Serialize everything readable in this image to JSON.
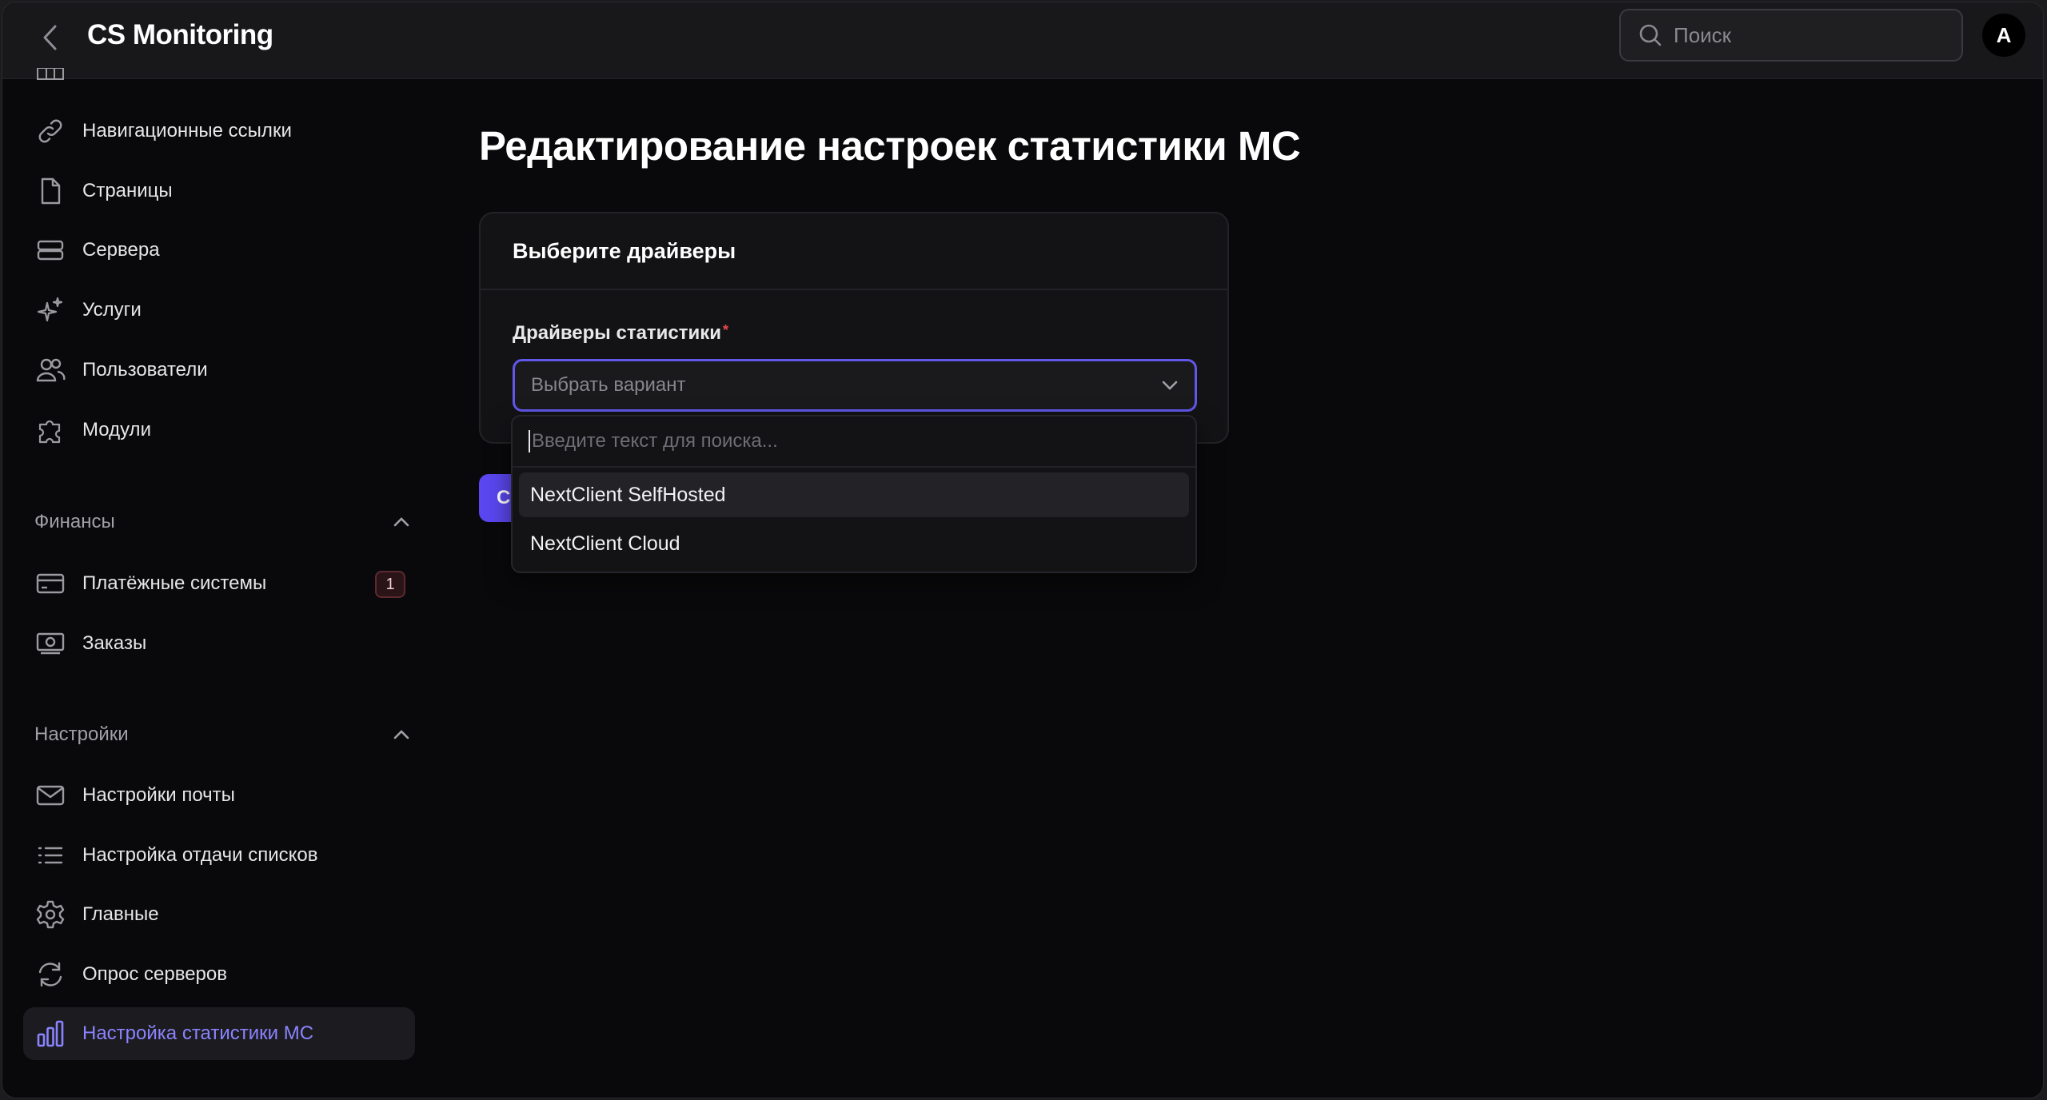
{
  "topbar": {
    "brand": "CS Monitoring",
    "search_placeholder": "Поиск",
    "avatar_initial": "A"
  },
  "sidebar": {
    "items_top": [
      {
        "label": "Навигационные ссылки",
        "icon": "link-icon"
      },
      {
        "label": "Страницы",
        "icon": "file-icon"
      },
      {
        "label": "Сервера",
        "icon": "server-icon"
      },
      {
        "label": "Услуги",
        "icon": "sparkles-icon"
      },
      {
        "label": "Пользователи",
        "icon": "users-icon"
      },
      {
        "label": "Модули",
        "icon": "puzzle-icon"
      }
    ],
    "finance": {
      "title": "Финансы",
      "items": [
        {
          "label": "Платёжные системы",
          "icon": "credit-card-icon",
          "badge": "1"
        },
        {
          "label": "Заказы",
          "icon": "banknote-icon"
        }
      ]
    },
    "settings": {
      "title": "Настройки",
      "items": [
        {
          "label": "Настройки почты",
          "icon": "mail-icon"
        },
        {
          "label": "Настройка отдачи списков",
          "icon": "list-icon"
        },
        {
          "label": "Главные",
          "icon": "gear-icon"
        },
        {
          "label": "Опрос серверов",
          "icon": "refresh-icon"
        },
        {
          "label": "Настройка статистики MC",
          "icon": "bar-chart-icon",
          "active": true
        }
      ]
    }
  },
  "main": {
    "title": "Редактирование настроек статистики MC",
    "card_title": "Выберите драйверы",
    "field_label": "Драйверы статистики",
    "required_mark": "*",
    "select_placeholder": "Выбрать вариант",
    "submit_label_visible": "C"
  },
  "dropdown": {
    "search_placeholder": "Введите текст для поиска...",
    "options": [
      "NextClient SelfHosted",
      "NextClient Cloud"
    ],
    "highlighted_index": 0
  },
  "colors": {
    "accent": "#5b47f0",
    "active_text": "#8b83ff",
    "background": "#09090b"
  }
}
